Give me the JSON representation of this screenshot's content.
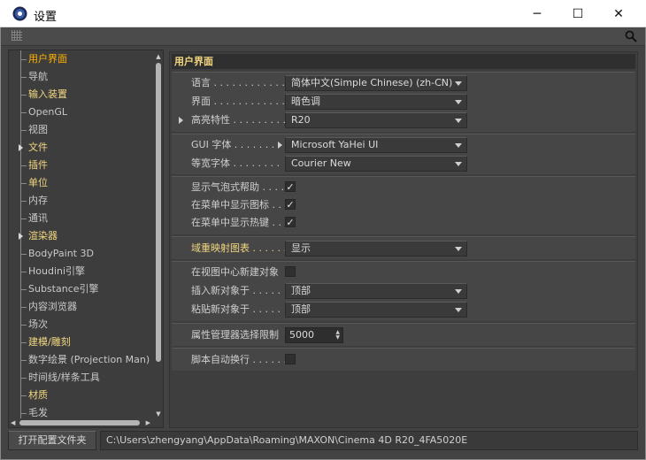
{
  "window": {
    "title": "设置",
    "controls": {
      "minimize": "─",
      "maximize": "☐",
      "close": "✕"
    }
  },
  "sidebar": {
    "items": [
      {
        "label": "用户界面",
        "style": "selected",
        "arrow": false
      },
      {
        "label": "导航",
        "style": "normal",
        "arrow": false
      },
      {
        "label": "输入装置",
        "style": "highlight",
        "arrow": false
      },
      {
        "label": "OpenGL",
        "style": "normal",
        "arrow": false
      },
      {
        "label": "视图",
        "style": "normal",
        "arrow": false
      },
      {
        "label": "文件",
        "style": "highlight",
        "arrow": true
      },
      {
        "label": "插件",
        "style": "highlight",
        "arrow": false
      },
      {
        "label": "单位",
        "style": "highlight",
        "arrow": false
      },
      {
        "label": "内存",
        "style": "normal",
        "arrow": false
      },
      {
        "label": "通讯",
        "style": "normal",
        "arrow": false
      },
      {
        "label": "渲染器",
        "style": "highlight",
        "arrow": true
      },
      {
        "label": "BodyPaint 3D",
        "style": "normal",
        "arrow": false
      },
      {
        "label": "Houdini引擎",
        "style": "normal",
        "arrow": false
      },
      {
        "label": "Substance引擎",
        "style": "normal",
        "arrow": false
      },
      {
        "label": "内容浏览器",
        "style": "normal",
        "arrow": false
      },
      {
        "label": "场次",
        "style": "normal",
        "arrow": false
      },
      {
        "label": "建模/雕刻",
        "style": "highlight",
        "arrow": false
      },
      {
        "label": "数字绘景 (Projection Man)",
        "style": "normal",
        "arrow": false
      },
      {
        "label": "时间线/样条工具",
        "style": "normal",
        "arrow": false
      },
      {
        "label": "材质",
        "style": "highlight",
        "arrow": false
      },
      {
        "label": "毛发",
        "style": "normal",
        "arrow": false
      }
    ]
  },
  "main": {
    "heading": "用户界面",
    "group1": {
      "language": {
        "label": "语言 . . . . . . . . . . . . . .",
        "value": "简体中文(Simple Chinese) (zh-CN)"
      },
      "scheme": {
        "label": "界面 . . . . . . . . . . . . . .",
        "value": "暗色调"
      },
      "highlight": {
        "label": "高亮特性 . . . . . . . . . .",
        "value": "R20"
      }
    },
    "group2": {
      "gui_font": {
        "label": "GUI 字体 . . . . . . .",
        "value": "Microsoft YaHei UI"
      },
      "mono_font": {
        "label": "等宽字体 . . . . . . . .",
        "value": "Courier New"
      }
    },
    "group3": {
      "bubble_help": {
        "label": "显示气泡式帮助 . . . .",
        "checked": "✓"
      },
      "menu_icons": {
        "label": "在菜单中显示图标 . .",
        "checked": "✓"
      },
      "menu_hotkeys": {
        "label": "在菜单中显示热键 . .",
        "checked": "✓"
      }
    },
    "group4": {
      "map_chart": {
        "label": "域重映射图表 . . . . . .",
        "value": "显示"
      }
    },
    "group5": {
      "center_new": {
        "label": "在视图中心新建对象",
        "checked": ""
      },
      "insert_new": {
        "label": "插入新对象于 . . . . .",
        "value": "顶部"
      },
      "paste_new": {
        "label": "粘贴新对象于 . . . . .",
        "value": "顶部"
      }
    },
    "group6": {
      "attr_limit": {
        "label": "属性管理器选择限制",
        "value": "5000"
      }
    },
    "group7": {
      "word_wrap": {
        "label": "脚本自动换行 . . . . . .",
        "checked": ""
      }
    }
  },
  "footer": {
    "open_folder_label": "打开配置文件夹",
    "path": "C:\\Users\\zhengyang\\AppData\\Roaming\\MAXON\\Cinema 4D R20_4FA5020E"
  }
}
